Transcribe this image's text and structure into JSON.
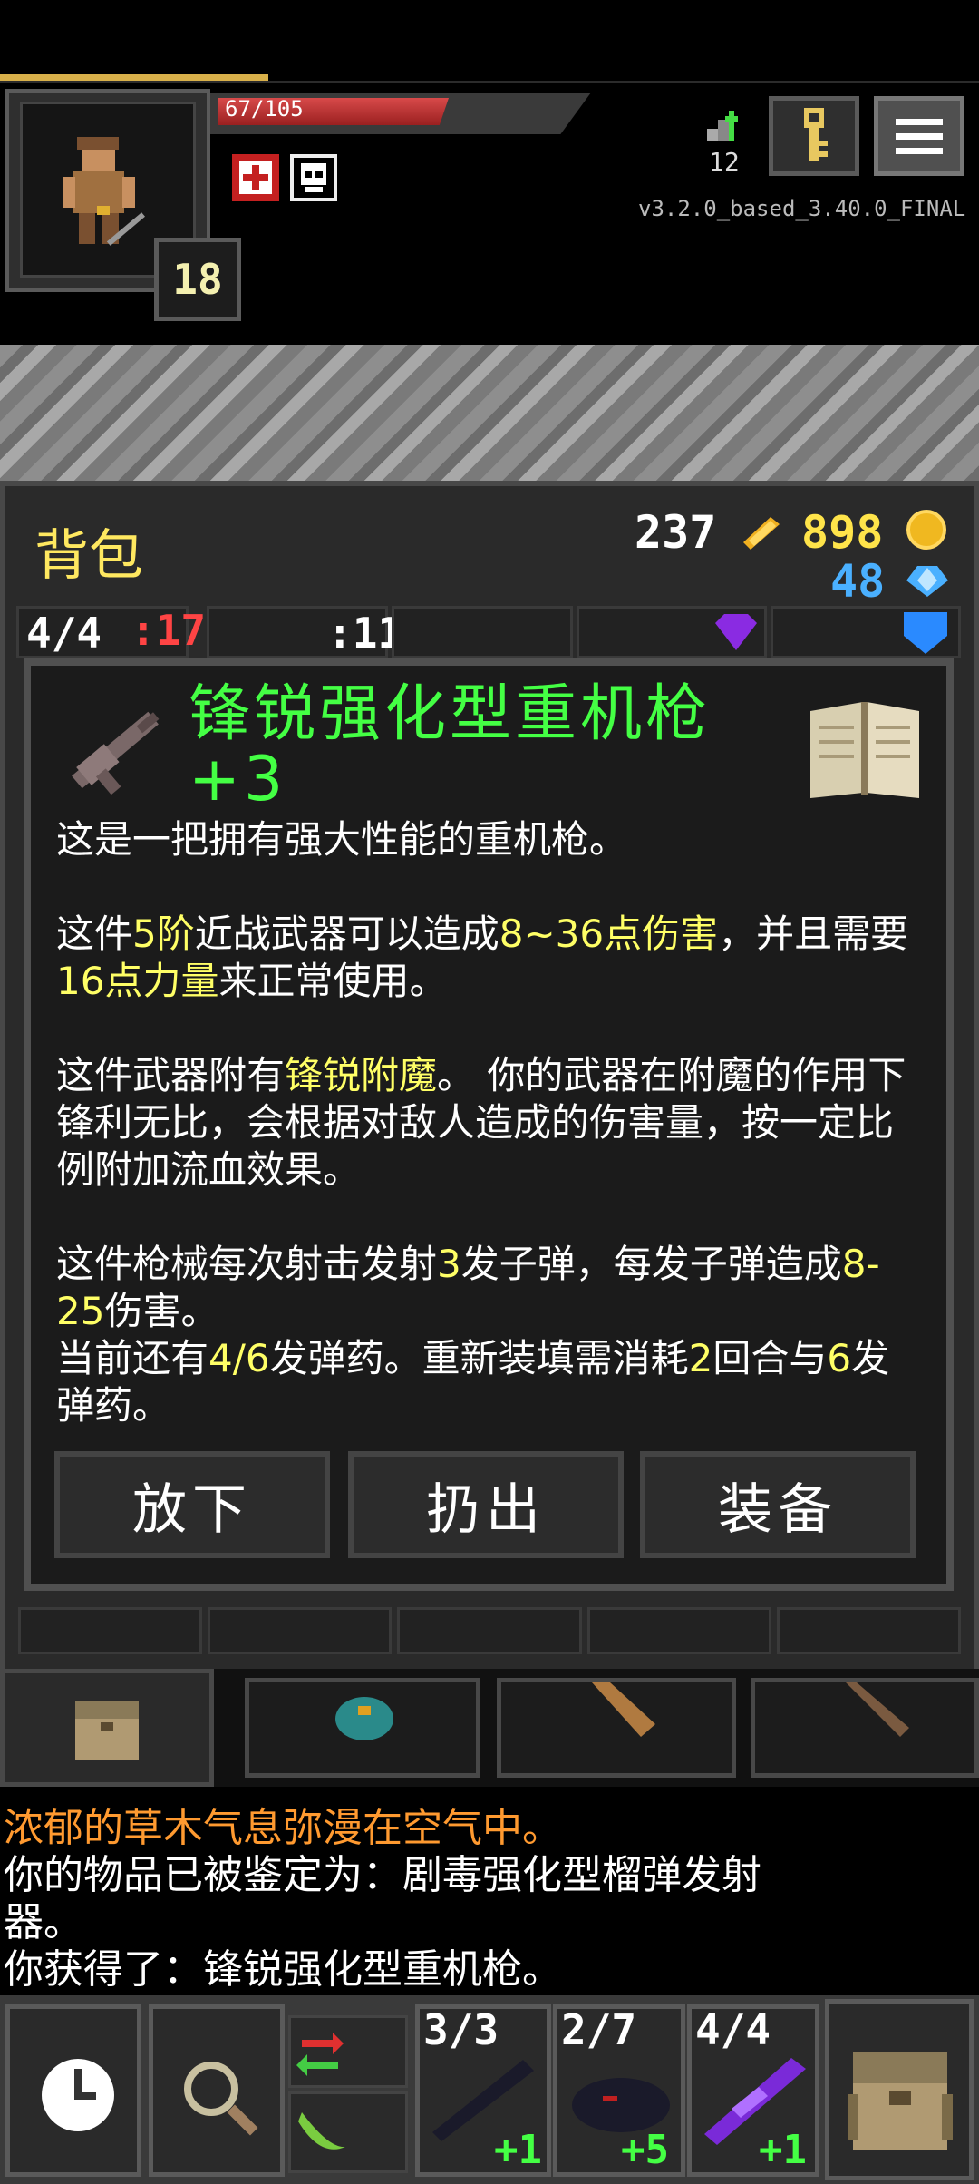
{
  "hud": {
    "hp": "67/105",
    "level": "18",
    "depth": "12",
    "version": "v3.2.0_based_3.40.0_FINAL"
  },
  "bag": {
    "title": "背包",
    "gold_count": "237",
    "coin_count": "898",
    "gem_count": "48",
    "tabs": [
      {
        "label": "4/4",
        "color": "#ffffff"
      },
      {
        "label": ":17",
        "color": "#ff4444"
      },
      {
        "label": ":11",
        "color": "#ffffff"
      }
    ]
  },
  "item": {
    "title_line1": "锋锐强化型重机枪",
    "title_line2": "+3",
    "p1": "这是一把拥有强大性能的重机枪。",
    "p2_a": "这件",
    "p2_b": "5阶",
    "p2_c": "近战武器可以造成",
    "p2_d": "8~36点伤害",
    "p2_e": "，并且需要",
    "p2_f": "16点力量",
    "p2_g": "来正常使用。",
    "p3_a": "这件武器附有",
    "p3_b": "锋锐附魔",
    "p3_c": "。 你的武器在附魔的作用下锋利无比，会根据对敌人造成的伤害量，按一定比例附加流血效果。",
    "p4_a": "这件枪械每次射击发射",
    "p4_b": "3",
    "p4_c": "发子弹，每发子弹造成",
    "p4_d": "8-25",
    "p4_e": "伤害。",
    "p5_a": "当前还有",
    "p5_b": "4/6",
    "p5_c": "发弹药。重新装填需消耗",
    "p5_d": "2",
    "p5_e": "回合与",
    "p5_f": "6",
    "p5_g": "发弹药。"
  },
  "buttons": {
    "drop": "放下",
    "throw": "扔出",
    "equip": "装备"
  },
  "log": {
    "line1": "浓郁的草木气息弥漫在空气中。",
    "line2": "你的物品已被鉴定为：剧毒强化型榴弹发射器。",
    "line3": "你获得了：锋锐强化型重机枪。"
  },
  "quickslots": [
    {
      "count": "3/3",
      "bonus": "+1"
    },
    {
      "count": "2/7",
      "bonus": "+5"
    },
    {
      "count": "4/4",
      "bonus": "+1"
    }
  ],
  "colors": {
    "title_green": "#44ff44",
    "highlight_yellow": "#ffff66",
    "log_orange": "#ff9a30"
  }
}
